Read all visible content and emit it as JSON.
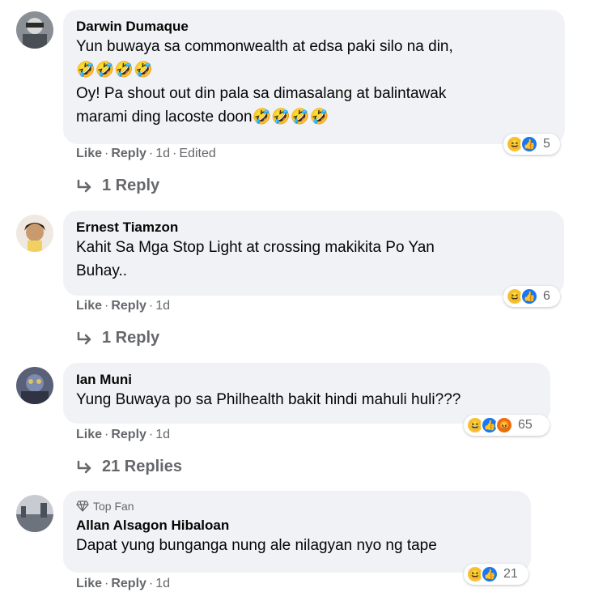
{
  "comments": [
    {
      "author": "Darwin Dumaque",
      "lines": [
        "Yun buwaya sa commonwealth at edsa paki silo na din,",
        "🤣🤣🤣🤣",
        "Oy! Pa shout out din pala sa dimasalang at balintawak",
        "marami ding lacoste doon🤣🤣🤣🤣"
      ],
      "reaction_count": "5",
      "reactions": [
        "haha",
        "like"
      ],
      "like_label": "Like",
      "reply_label": "Reply",
      "time": "1d",
      "edited": "Edited",
      "replies_label": "1 Reply"
    },
    {
      "author": "Ernest Tiamzon",
      "lines": [
        "Kahit Sa Mga Stop Light at crossing makikita Po Yan",
        "Buhay.."
      ],
      "reaction_count": "6",
      "reactions": [
        "haha",
        "like"
      ],
      "like_label": "Like",
      "reply_label": "Reply",
      "time": "1d",
      "replies_label": "1 Reply"
    },
    {
      "author": "Ian Muni",
      "lines": [
        "Yung Buwaya po sa Philhealth bakit hindi mahuli huli???"
      ],
      "reaction_count": "65",
      "reactions": [
        "haha",
        "like",
        "angry"
      ],
      "like_label": "Like",
      "reply_label": "Reply",
      "time": "1d",
      "replies_label": "21 Replies"
    },
    {
      "badge": "Top Fan",
      "author": "Allan Alsagon Hibaloan",
      "lines": [
        "Dapat yung bunganga nung ale nilagyan nyo ng tape"
      ],
      "reaction_count": "21",
      "reactions": [
        "haha",
        "like"
      ],
      "like_label": "Like",
      "reply_label": "Reply",
      "time": "1d"
    }
  ],
  "colors": {
    "bubble": "#f0f2f5",
    "secondary_text": "#65676b",
    "like_blue": "#1877f2",
    "haha_yellow": "#f7c233",
    "angry_orange": "#e9710f"
  }
}
